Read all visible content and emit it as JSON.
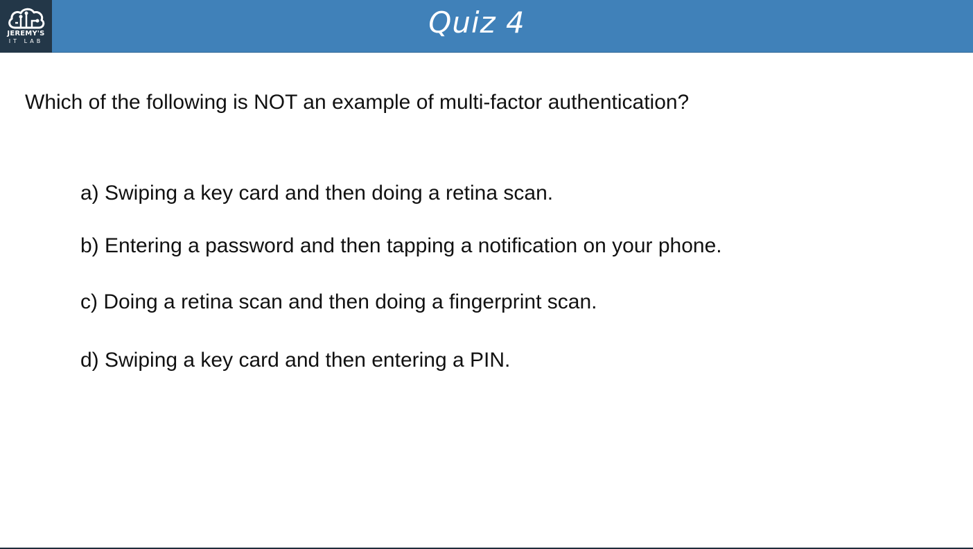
{
  "header": {
    "title": "Quiz 4",
    "logo": {
      "line1": "JEREMY'S",
      "line2": "IT LAB",
      "icon": "cloud-circuit-icon"
    },
    "colors": {
      "banner": "#4081b9",
      "logo_bg": "#233748"
    }
  },
  "question": {
    "text": "Which of the following is NOT an example of multi-factor authentication?"
  },
  "options": [
    {
      "label": "a) Swiping a key card and then doing a retina scan."
    },
    {
      "label": "b) Entering a password and then tapping a notification on your phone."
    },
    {
      "label": "c) Doing a retina scan and then doing a fingerprint scan."
    },
    {
      "label": "d) Swiping a key card and then entering a PIN."
    }
  ]
}
